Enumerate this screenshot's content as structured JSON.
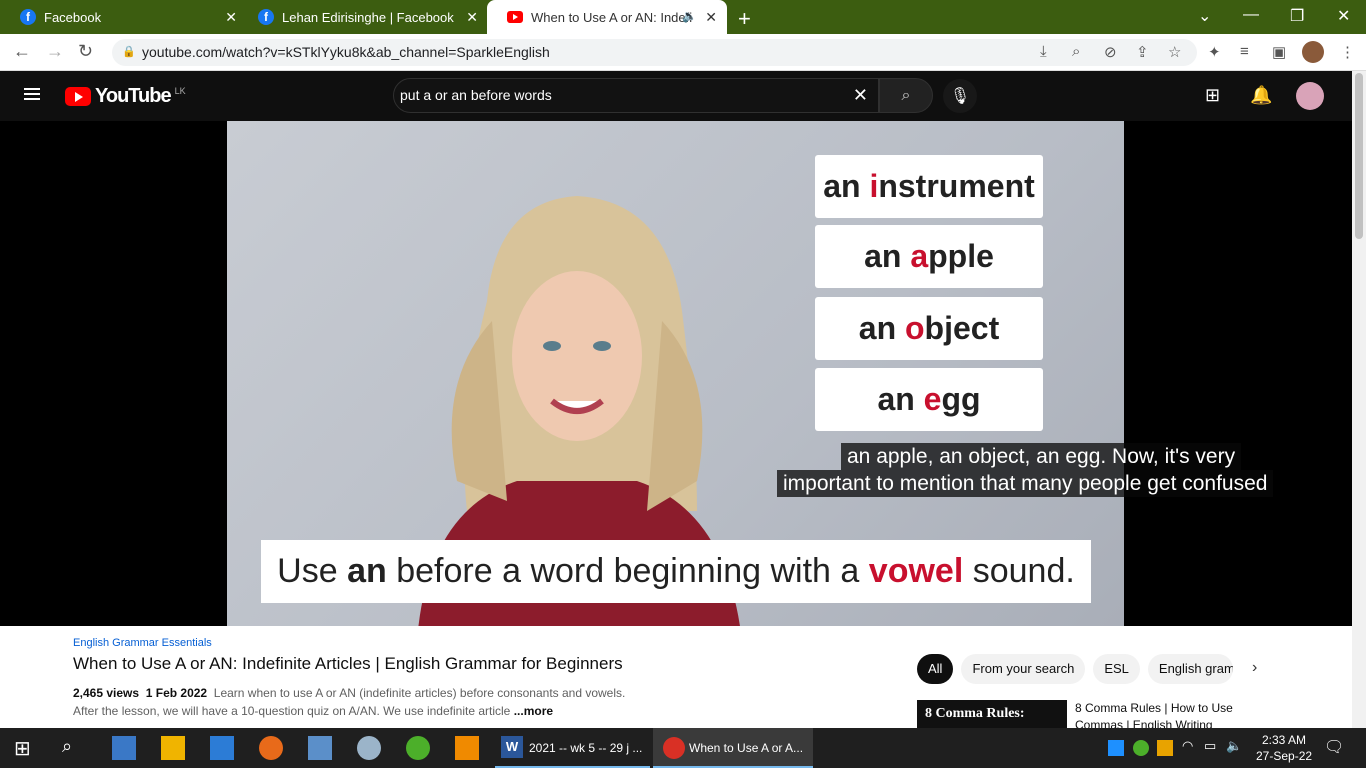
{
  "browser": {
    "tabs": [
      {
        "title": "Facebook",
        "icon": "facebook-icon"
      },
      {
        "title": "Lehan Edirisinghe | Facebook",
        "icon": "facebook-icon"
      },
      {
        "title": "When to Use A or AN: Indefi",
        "icon": "youtube-icon"
      }
    ],
    "url": "youtube.com/watch?v=kSTklYyku8k&ab_channel=SparkleEnglish"
  },
  "youtube": {
    "logo_text": "YouTube",
    "region": "LK",
    "search_value": "put a or an before words"
  },
  "video": {
    "word_cards": [
      {
        "prefix": "an ",
        "highlight": "i",
        "rest": "nstrument"
      },
      {
        "prefix": "an ",
        "highlight": "a",
        "rest": "pple"
      },
      {
        "prefix": "an ",
        "highlight": "o",
        "rest": "bject"
      },
      {
        "prefix": "an ",
        "highlight": "e",
        "rest": "gg"
      }
    ],
    "caption_line1": "an apple, an object, an egg. Now, it's very",
    "caption_line2": "important to mention that many people get confused",
    "rule": {
      "part1": "Use ",
      "bold": "an",
      "part2": " before a word beginning with a ",
      "red": "vowel",
      "part3": " sound."
    }
  },
  "info": {
    "channel": "English Grammar Essentials",
    "title": "When to Use A or AN: Indefinite Articles | English Grammar for Beginners",
    "views": "2,465 views",
    "date": "1 Feb 2022",
    "description": "Learn when to use A or AN (indefinite articles) before consonants and vowels. After the lesson, we will have a 10-question quiz on A/AN.  We use indefinite article",
    "more": "...more"
  },
  "chips": [
    "All",
    "From your search",
    "ESL",
    "English gram"
  ],
  "recommendation": {
    "thumb_text": "8 Comma Rules:",
    "title": "8 Comma Rules | How to Use Commas | English Writing"
  },
  "taskbar": {
    "tasks": [
      "2021 -- wk 5 -- 29 j ...",
      "When to Use A or A..."
    ],
    "time": "2:33 AM",
    "date": "27-Sep-22"
  }
}
